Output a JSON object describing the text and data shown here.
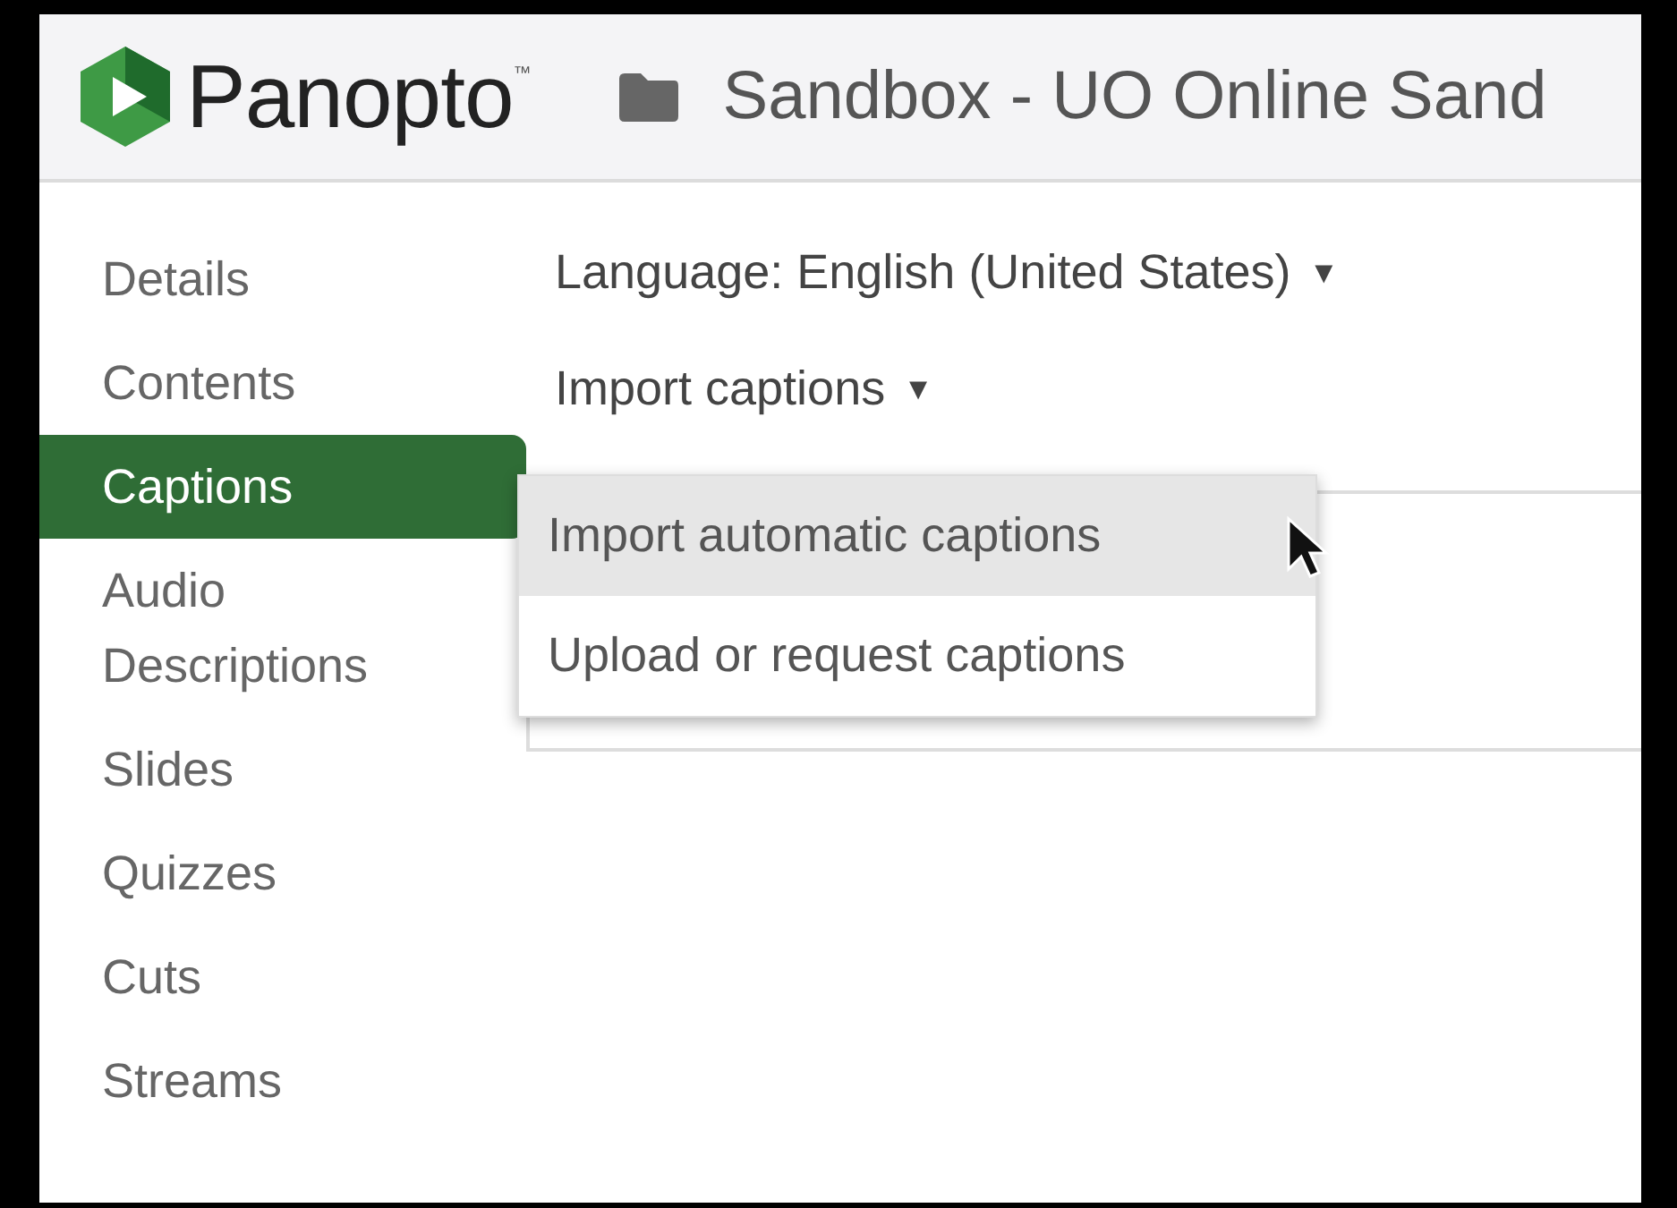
{
  "header": {
    "logo_text": "Panopto",
    "logo_mark": "™",
    "folder_title": "Sandbox - UO Online Sand"
  },
  "sidebar": {
    "items": [
      {
        "label": "Details",
        "selected": false
      },
      {
        "label": "Contents",
        "selected": false
      },
      {
        "label": "Captions",
        "selected": true
      },
      {
        "label": "Audio Descriptions",
        "selected": false
      },
      {
        "label": "Slides",
        "selected": false
      },
      {
        "label": "Quizzes",
        "selected": false
      },
      {
        "label": "Cuts",
        "selected": false
      },
      {
        "label": "Streams",
        "selected": false
      }
    ]
  },
  "language_dropdown": {
    "label": "Language: English (United States)",
    "caret": "▼"
  },
  "import_dropdown": {
    "label": "Import captions",
    "caret": "▼",
    "expanded": true,
    "menu": [
      {
        "label": "Import automatic captions",
        "selected": true
      },
      {
        "label": "Upload or request captions",
        "selected": false
      }
    ]
  }
}
